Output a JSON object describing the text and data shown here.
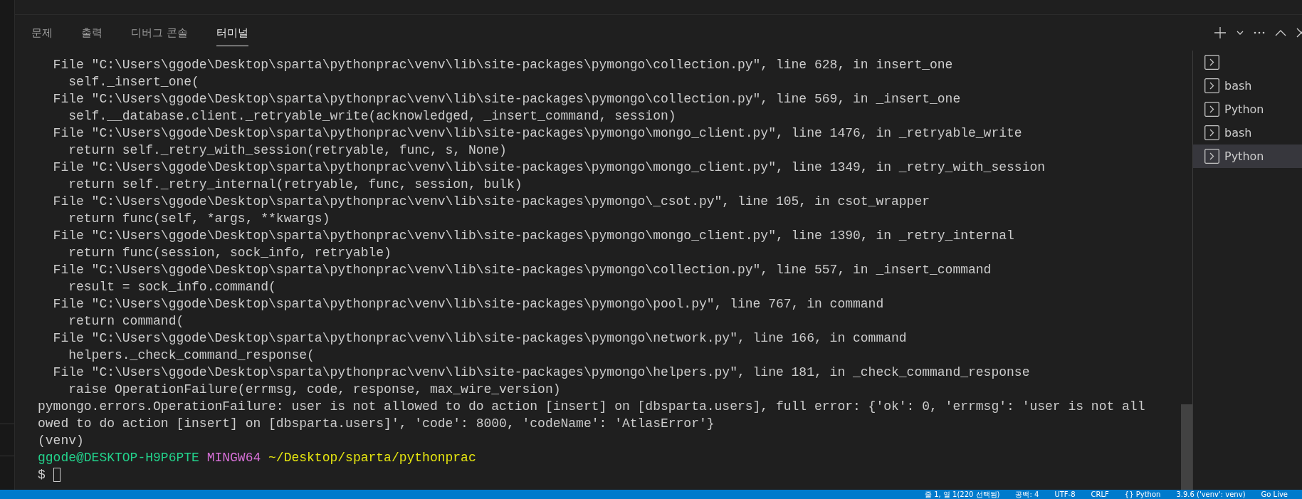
{
  "panel_tabs": [
    {
      "label": "문제",
      "selected": false
    },
    {
      "label": "출력",
      "selected": false
    },
    {
      "label": "디버그 콘솔",
      "selected": false
    },
    {
      "label": "터미널",
      "selected": true
    }
  ],
  "terminal": {
    "lines": [
      {
        "kind": "plain",
        "text": "  File \"C:\\Users\\ggode\\Desktop\\sparta\\pythonprac\\venv\\lib\\site-packages\\pymongo\\collection.py\", line 628, in insert_one"
      },
      {
        "kind": "plain",
        "text": "    self._insert_one("
      },
      {
        "kind": "plain",
        "text": "  File \"C:\\Users\\ggode\\Desktop\\sparta\\pythonprac\\venv\\lib\\site-packages\\pymongo\\collection.py\", line 569, in _insert_one"
      },
      {
        "kind": "plain",
        "text": "    self.__database.client._retryable_write(acknowledged, _insert_command, session)"
      },
      {
        "kind": "plain",
        "text": "  File \"C:\\Users\\ggode\\Desktop\\sparta\\pythonprac\\venv\\lib\\site-packages\\pymongo\\mongo_client.py\", line 1476, in _retryable_write"
      },
      {
        "kind": "plain",
        "text": "    return self._retry_with_session(retryable, func, s, None)"
      },
      {
        "kind": "plain",
        "text": "  File \"C:\\Users\\ggode\\Desktop\\sparta\\pythonprac\\venv\\lib\\site-packages\\pymongo\\mongo_client.py\", line 1349, in _retry_with_session"
      },
      {
        "kind": "plain",
        "text": "    return self._retry_internal(retryable, func, session, bulk)"
      },
      {
        "kind": "plain",
        "text": "  File \"C:\\Users\\ggode\\Desktop\\sparta\\pythonprac\\venv\\lib\\site-packages\\pymongo\\_csot.py\", line 105, in csot_wrapper"
      },
      {
        "kind": "plain",
        "text": "    return func(self, *args, **kwargs)"
      },
      {
        "kind": "plain",
        "text": "  File \"C:\\Users\\ggode\\Desktop\\sparta\\pythonprac\\venv\\lib\\site-packages\\pymongo\\mongo_client.py\", line 1390, in _retry_internal"
      },
      {
        "kind": "plain",
        "text": "    return func(session, sock_info, retryable)"
      },
      {
        "kind": "plain",
        "text": "  File \"C:\\Users\\ggode\\Desktop\\sparta\\pythonprac\\venv\\lib\\site-packages\\pymongo\\collection.py\", line 557, in _insert_command"
      },
      {
        "kind": "plain",
        "text": "    result = sock_info.command("
      },
      {
        "kind": "plain",
        "text": "  File \"C:\\Users\\ggode\\Desktop\\sparta\\pythonprac\\venv\\lib\\site-packages\\pymongo\\pool.py\", line 767, in command"
      },
      {
        "kind": "plain",
        "text": "    return command("
      },
      {
        "kind": "plain",
        "text": "  File \"C:\\Users\\ggode\\Desktop\\sparta\\pythonprac\\venv\\lib\\site-packages\\pymongo\\network.py\", line 166, in command"
      },
      {
        "kind": "plain",
        "text": "    helpers._check_command_response("
      },
      {
        "kind": "plain",
        "text": "  File \"C:\\Users\\ggode\\Desktop\\sparta\\pythonprac\\venv\\lib\\site-packages\\pymongo\\helpers.py\", line 181, in _check_command_response"
      },
      {
        "kind": "plain",
        "text": "    raise OperationFailure(errmsg, code, response, max_wire_version)"
      },
      {
        "kind": "plain",
        "text": "pymongo.errors.OperationFailure: user is not allowed to do action [insert] on [dbsparta.users], full error: {'ok': 0, 'errmsg': 'user is not all"
      },
      {
        "kind": "plain",
        "text": "owed to do action [insert] on [dbsparta.users]', 'code': 8000, 'codeName': 'AtlasError'}"
      },
      {
        "kind": "plain",
        "text": "(venv)"
      },
      {
        "kind": "prompt",
        "user": "ggode@DESKTOP-H9P6PTE",
        "system": "MINGW64",
        "path": "~/Desktop/sparta/pythonprac"
      },
      {
        "kind": "input",
        "text": "$"
      }
    ]
  },
  "terminal_list": [
    {
      "selected": false
    },
    {
      "label": "bash",
      "selected": false
    },
    {
      "label": "Python",
      "selected": false
    },
    {
      "label": "bash",
      "selected": false
    },
    {
      "label": "Python",
      "selected": true
    }
  ],
  "status_bar": [
    "줄 1, 열 1(220 선택됨)",
    "공백: 4",
    "UTF-8",
    "CRLF",
    "{} Python",
    "3.9.6 ('venv': venv)",
    "Go Live"
  ]
}
